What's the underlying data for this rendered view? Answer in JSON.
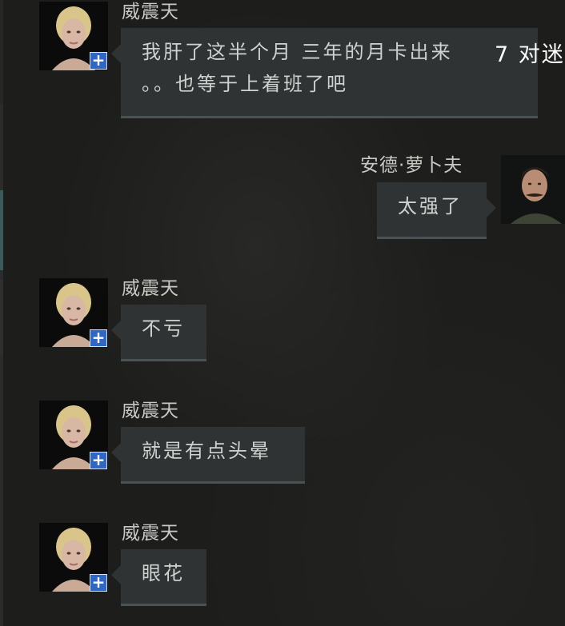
{
  "conversation": {
    "messages": [
      {
        "sender": "威震天",
        "text_line1": "我肝了这半个月 三年的月卡出来",
        "text_line2": "。。也等于上着班了吧",
        "avatar_icon": "female-character-portrait",
        "badge": "+"
      },
      {
        "sender": "安德·萝卜夫",
        "text": "太强了",
        "avatar_icon": "male-character-portrait"
      },
      {
        "sender": "威震天",
        "text": "不亏",
        "avatar_icon": "female-character-portrait",
        "badge": "+"
      },
      {
        "sender": "威震天",
        "text": "就是有点头晕",
        "avatar_icon": "female-character-portrait",
        "badge": "+"
      },
      {
        "sender": "威震天",
        "text": "眼花",
        "avatar_icon": "female-character-portrait",
        "badge": "+"
      }
    ]
  },
  "overlay": {
    "clipped_text": "7 对迷"
  },
  "colors": {
    "background": "#1d1d1c",
    "bubble": "#2f3334",
    "bubble_border": "#4a5253",
    "sender_text": "#c8c8c4",
    "message_text": "#cfd2cf",
    "badge": "#2f67c7",
    "rail_accent": "#3a5a5c"
  }
}
